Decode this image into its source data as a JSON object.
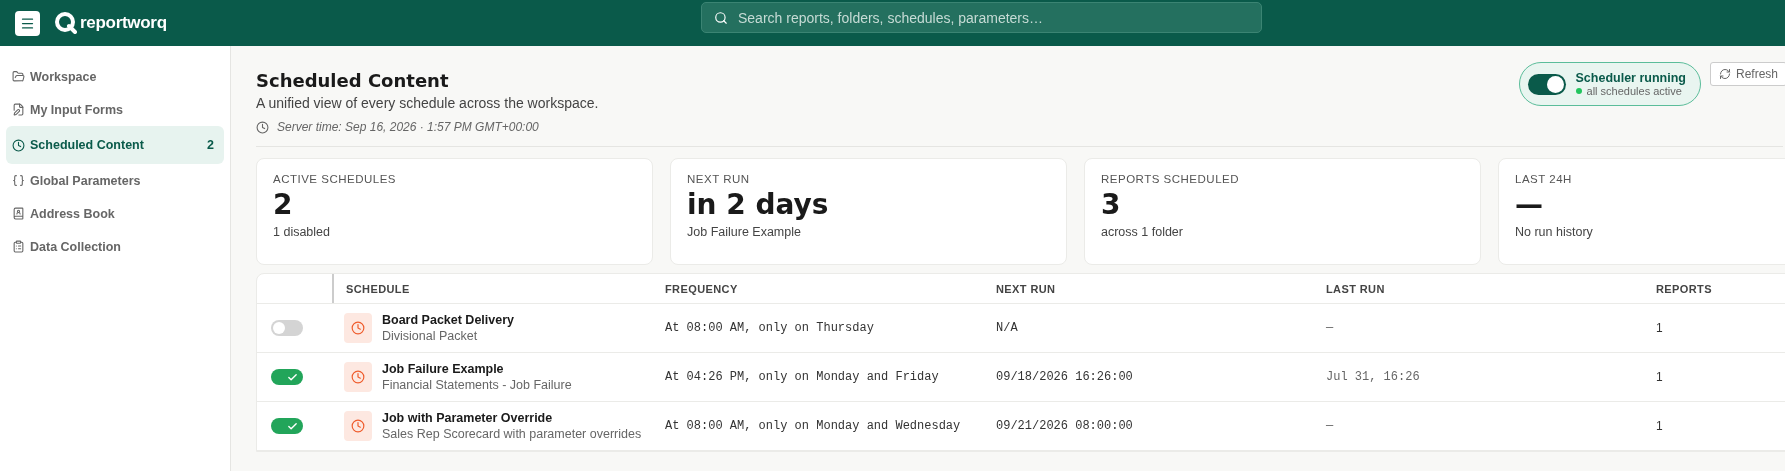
{
  "header": {
    "brand": "reportworq",
    "search": {
      "placeholder": "Search reports, folders, schedules, parameters…"
    }
  },
  "sidebar": {
    "items": [
      {
        "label": "Workspace",
        "selected": false
      },
      {
        "label": "My Input Forms",
        "selected": false
      },
      {
        "label": "Scheduled Content",
        "selected": true,
        "count": "2"
      },
      {
        "label": "Global Parameters",
        "selected": false
      },
      {
        "label": "Address Book",
        "selected": false
      },
      {
        "label": "Data Collection",
        "selected": false
      }
    ]
  },
  "page": {
    "title": "Scheduled Content",
    "subtitle": "A unified view of every schedule across the workspace.",
    "server_time": "Server time: Sep 16, 2026 · 1:57 PM GMT+00:00"
  },
  "scheduler": {
    "on": true,
    "label": "Scheduler running",
    "status": "all schedules active"
  },
  "refresh_button": "Refresh",
  "stats": [
    {
      "label": "ACTIVE SCHEDULES",
      "value": "2",
      "note": "1 disabled"
    },
    {
      "label": "NEXT RUN",
      "value": "in 2 days",
      "note": "Job Failure Example"
    },
    {
      "label": "REPORTS SCHEDULED",
      "value": "3",
      "note": "across 1 folder"
    },
    {
      "label": "LAST 24H",
      "value": "—",
      "note": "No run history"
    }
  ],
  "table": {
    "columns": [
      "SCHEDULE",
      "FREQUENCY",
      "NEXT RUN",
      "LAST RUN",
      "REPORTS"
    ],
    "rows": [
      {
        "enabled": false,
        "name": "Board Packet Delivery",
        "subtitle": "Divisional Packet",
        "frequency": "At 08:00 AM, only on Thursday",
        "next_run": "N/A",
        "last_run": "—",
        "reports": "1"
      },
      {
        "enabled": true,
        "name": "Job Failure Example",
        "subtitle": "Financial Statements - Job Failure",
        "frequency": "At 04:26 PM, only on Monday and Friday",
        "next_run": "09/18/2026 16:26:00",
        "last_run": "Jul 31, 16:26",
        "reports": "1"
      },
      {
        "enabled": true,
        "name": "Job with Parameter Override",
        "subtitle": "Sales Rep Scorecard with parameter overrides",
        "frequency": "At 08:00 AM, only on Monday and Wednesday",
        "next_run": "09/21/2026 08:00:00",
        "last_run": "—",
        "reports": "1"
      }
    ]
  }
}
